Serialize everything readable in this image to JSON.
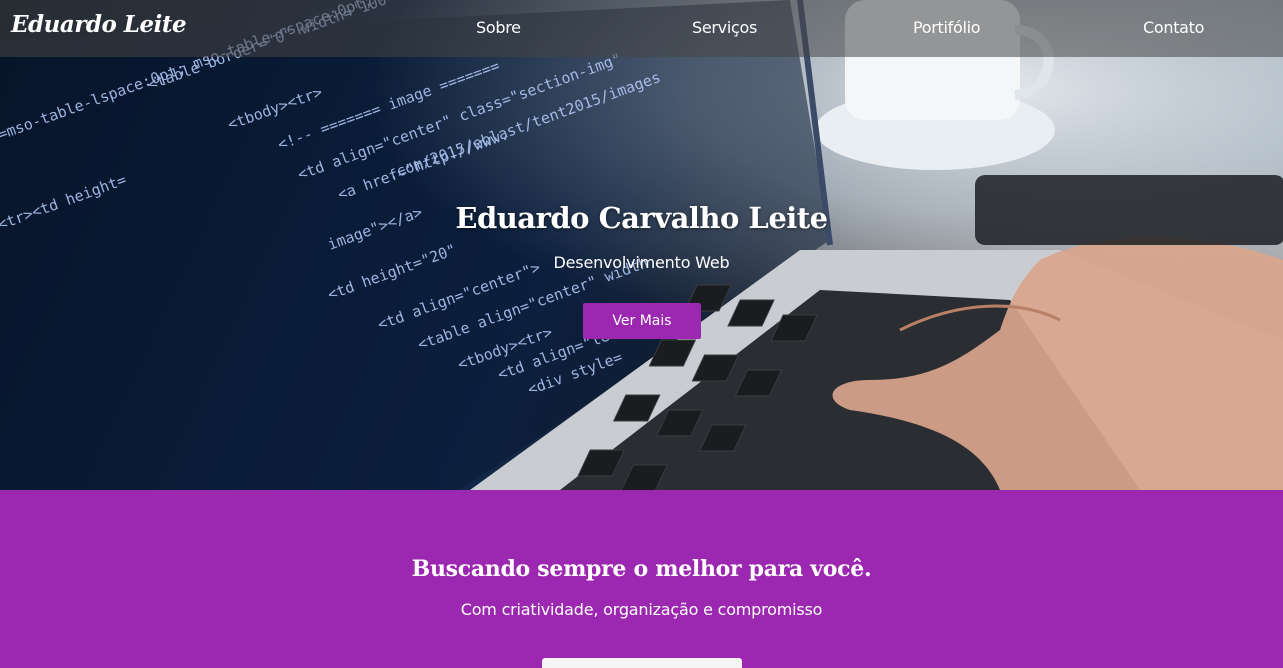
{
  "nav": {
    "brand": "Eduardo Leite",
    "links": [
      "Sobre",
      "Serviços",
      "Portifólio",
      "Contato"
    ]
  },
  "hero": {
    "title": "Eduardo Carvalho Leite",
    "subtitle": "Desenvolvimento Web",
    "button_label": "Ver Mais"
  },
  "section": {
    "title": "Buscando sempre o melhor para você.",
    "subtitle": "Com criatividade, organização e compromisso"
  },
  "colors": {
    "accent": "#9c27b0",
    "nav_bg": "rgba(70,70,70,0.55)",
    "text": "#ffffff"
  }
}
